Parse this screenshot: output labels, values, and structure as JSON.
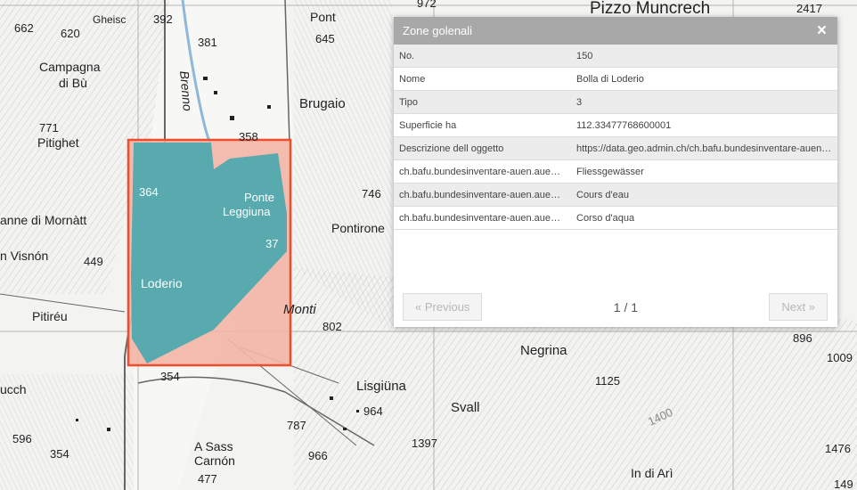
{
  "popup": {
    "title": "Zone golenali",
    "close_label": "×",
    "rows": [
      {
        "key": "No.",
        "value": "150"
      },
      {
        "key": "Nome",
        "value": "Bolla di Loderio"
      },
      {
        "key": "Tipo",
        "value": "3"
      },
      {
        "key": "Superficie ha",
        "value": "112.33477768600001"
      },
      {
        "key": "Descrizione dell oggetto",
        "value": "https://data.geo.admin.ch/ch.bafu.bundesinventare-auen…"
      },
      {
        "key": "ch.bafu.bundesinventare-auen.auen t…",
        "value": "Fliessgewässer"
      },
      {
        "key": "ch.bafu.bundesinventare-auen.auen t…",
        "value": "Cours d'eau"
      },
      {
        "key": "ch.bafu.bundesinventare-auen.auen t…",
        "value": "Corso d'aqua"
      }
    ],
    "pager": {
      "prev": "« Previous",
      "count": "1 / 1",
      "next": "Next »"
    }
  },
  "map": {
    "place_names": [
      "Pizzo Muncrech",
      "Campagna di Bù",
      "Pitighet",
      "anne di Mornàtt",
      "n Visnón",
      "Pitiréu",
      "ucch",
      "Brenno",
      "Brugaio",
      "Ponte Leggiuna",
      "Pontirone",
      "Loderio",
      "Monti",
      "Negrina",
      "Lisgiüna",
      "Svall",
      "A Sass Carnón",
      "In di Arì",
      "Gheisc",
      "Pont"
    ],
    "heights": [
      "2417",
      "972",
      "392",
      "662",
      "620",
      "381",
      "645",
      "771",
      "358",
      "364",
      "746",
      "449",
      "802",
      "354",
      "964",
      "1125",
      "787",
      "1397",
      "596",
      "966",
      "477",
      "896",
      "1009",
      "1476",
      "149",
      "1400",
      "37"
    ],
    "colors": {
      "polygon_fill": "#4fa9ae",
      "buffer_fill": "#f2b5a6",
      "selection_border": "#ef4d2c"
    }
  }
}
